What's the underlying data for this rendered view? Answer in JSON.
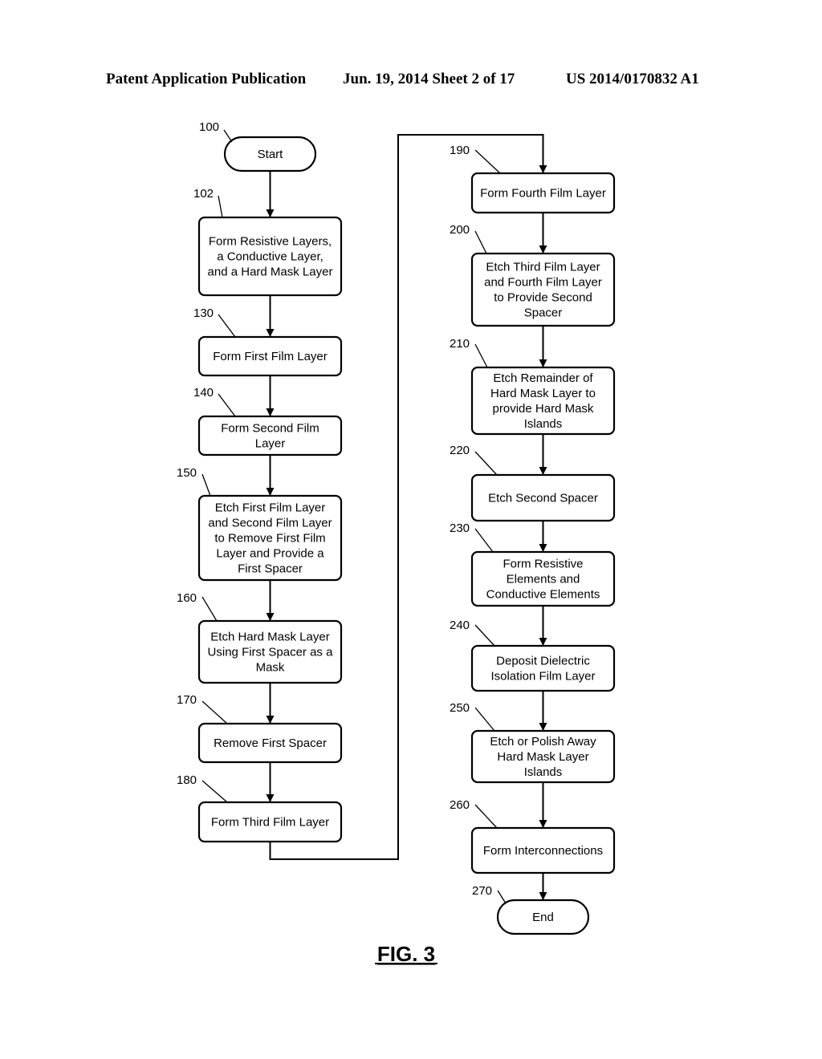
{
  "header": {
    "publication": "Patent Application Publication",
    "date_sheet": "Jun. 19, 2014  Sheet 2 of 17",
    "number": "US 2014/0170832 A1"
  },
  "figure_label": "FIG. 3",
  "steps": [
    {
      "id": "100",
      "shape": "terminal",
      "lines": [
        "Start"
      ]
    },
    {
      "id": "102",
      "shape": "process",
      "lines": [
        "Form Resistive Layers,",
        "a Conductive Layer,",
        "and a Hard Mask Layer"
      ]
    },
    {
      "id": "130",
      "shape": "process",
      "lines": [
        "Form First Film Layer"
      ]
    },
    {
      "id": "140",
      "shape": "process",
      "lines": [
        "Form Second Film",
        "Layer"
      ]
    },
    {
      "id": "150",
      "shape": "process",
      "lines": [
        "Etch First Film Layer",
        "and Second Film Layer",
        "to Remove First Film",
        "Layer and Provide a",
        "First Spacer"
      ]
    },
    {
      "id": "160",
      "shape": "process",
      "lines": [
        "Etch Hard Mask Layer",
        "Using First Spacer as a",
        "Mask"
      ]
    },
    {
      "id": "170",
      "shape": "process",
      "lines": [
        "Remove First Spacer"
      ]
    },
    {
      "id": "180",
      "shape": "process",
      "lines": [
        "Form Third Film Layer"
      ]
    },
    {
      "id": "190",
      "shape": "process",
      "lines": [
        "Form Fourth Film Layer"
      ]
    },
    {
      "id": "200",
      "shape": "process",
      "lines": [
        "Etch Third Film Layer",
        "and Fourth Film Layer",
        "to Provide Second",
        "Spacer"
      ]
    },
    {
      "id": "210",
      "shape": "process",
      "lines": [
        "Etch Remainder of",
        "Hard Mask Layer  to",
        "provide Hard Mask",
        "Islands"
      ]
    },
    {
      "id": "220",
      "shape": "process",
      "lines": [
        "Etch Second Spacer"
      ]
    },
    {
      "id": "230",
      "shape": "process",
      "lines": [
        "Form Resistive",
        "Elements and",
        "Conductive Elements"
      ]
    },
    {
      "id": "240",
      "shape": "process",
      "lines": [
        "Deposit Dielectric",
        "Isolation Film Layer"
      ]
    },
    {
      "id": "250",
      "shape": "process",
      "lines": [
        "Etch or Polish Away",
        "Hard Mask Layer",
        "Islands"
      ]
    },
    {
      "id": "260",
      "shape": "process",
      "lines": [
        "Form Interconnections"
      ]
    },
    {
      "id": "270",
      "shape": "terminal",
      "lines": [
        "End"
      ]
    }
  ],
  "edges": [
    [
      "100",
      "102"
    ],
    [
      "102",
      "130"
    ],
    [
      "130",
      "140"
    ],
    [
      "140",
      "150"
    ],
    [
      "150",
      "160"
    ],
    [
      "160",
      "170"
    ],
    [
      "170",
      "180"
    ],
    [
      "180",
      "190"
    ],
    [
      "190",
      "200"
    ],
    [
      "200",
      "210"
    ],
    [
      "210",
      "220"
    ],
    [
      "220",
      "230"
    ],
    [
      "230",
      "240"
    ],
    [
      "240",
      "250"
    ],
    [
      "250",
      "260"
    ],
    [
      "260",
      "270"
    ]
  ]
}
